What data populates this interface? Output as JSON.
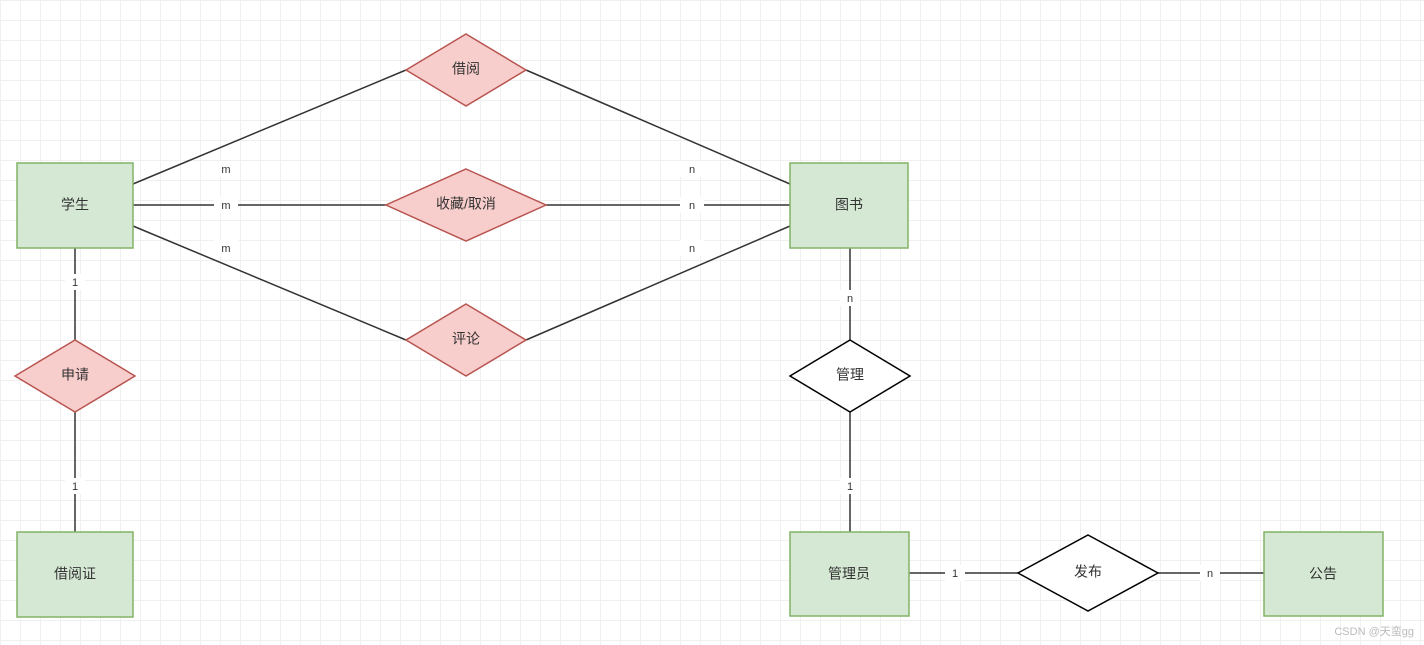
{
  "entities": {
    "student": "学生",
    "borrowcard": "借阅证",
    "book": "图书",
    "admin": "管理员",
    "notice": "公告"
  },
  "relationships": {
    "borrow": "借阅",
    "favorite": "收藏/取消",
    "comment": "评论",
    "apply": "申请",
    "manage": "管理",
    "publish": "发布"
  },
  "cardinalities": {
    "student_borrow": "m",
    "borrow_book": "n",
    "student_favorite": "m",
    "favorite_book": "n",
    "student_comment": "m",
    "comment_book": "n",
    "student_apply": "1",
    "apply_card": "1",
    "book_manage": "n",
    "manage_admin": "1",
    "admin_publish": "1",
    "publish_notice": "n"
  },
  "colors": {
    "entity_fill": "#d5e8d4",
    "entity_stroke": "#82b366",
    "rel_pink_fill": "#f8cecc",
    "rel_pink_stroke": "#b85450",
    "rel_white_fill": "#ffffff",
    "rel_white_stroke": "#000000",
    "line": "#333333"
  },
  "watermark": "CSDN @天蛮gg"
}
